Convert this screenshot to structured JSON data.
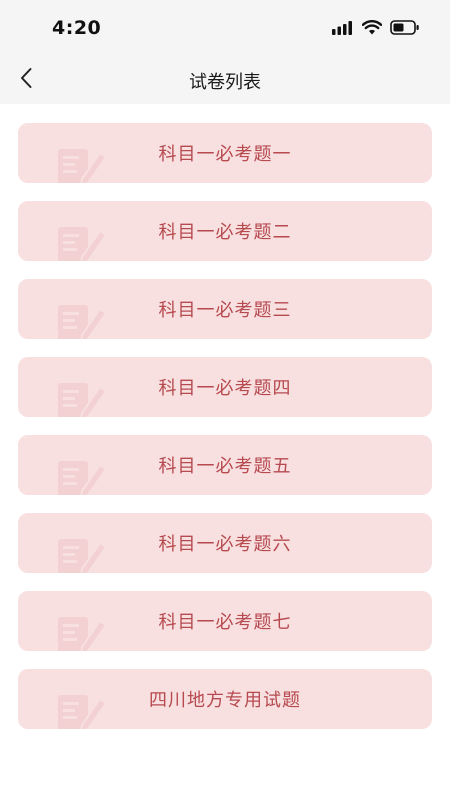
{
  "status_bar": {
    "time": "4:20",
    "icons": [
      "signal-icon",
      "wifi-icon",
      "battery-icon"
    ]
  },
  "nav": {
    "title": "试卷列表",
    "back_icon": "chevron-left-icon"
  },
  "papers": [
    {
      "label": "科目一必考题一"
    },
    {
      "label": "科目一必考题二"
    },
    {
      "label": "科目一必考题三"
    },
    {
      "label": "科目一必考题四"
    },
    {
      "label": "科目一必考题五"
    },
    {
      "label": "科目一必考题六"
    },
    {
      "label": "科目一必考题七"
    },
    {
      "label": "四川地方专用试题"
    }
  ],
  "colors": {
    "item_bg": "#f8dfe0",
    "item_text": "#b64a4f",
    "watermark": "#eec4c6",
    "header_bg": "#f5f5f5"
  }
}
